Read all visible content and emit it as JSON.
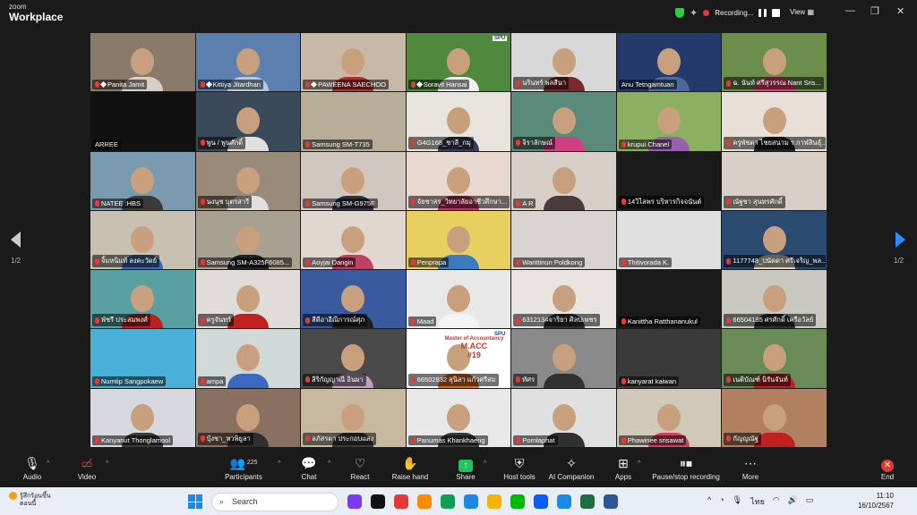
{
  "app": {
    "brand_small": "zoom",
    "brand_large": "Workplace"
  },
  "titlebar": {
    "recording_label": "Recording...",
    "view_label": "View",
    "minimize": "—",
    "restore": "❐",
    "close": "✕"
  },
  "pager": {
    "left": "1/2",
    "right": "1/2"
  },
  "participants": [
    {
      "name": "Panita Jamit",
      "pinned": true,
      "muted": true,
      "bg": "#8a7a6a",
      "shirt": "#d8d0c8"
    },
    {
      "name": "Kittiya Jitardhan",
      "pinned": true,
      "muted": true,
      "bg": "#5c7fb0",
      "shirt": "#b0c8e0"
    },
    {
      "name": "PAWEENA SAECHOO",
      "pinned": true,
      "muted": true,
      "bg": "#c8b8a8",
      "shirt": "#b03030"
    },
    {
      "name": "Soravit Hansai",
      "pinned": true,
      "muted": true,
      "bg": "#4f8a3c",
      "shirt": "#f0f0f0",
      "logo": "SPU"
    },
    {
      "name": "นรินทร์ พลสีนา",
      "pinned": false,
      "muted": true,
      "bg": "#d8d8d8",
      "shirt": "#7a2a2a"
    },
    {
      "name": "Anu Tetngamtuan",
      "pinned": false,
      "muted": false,
      "bg": "#233a6a",
      "shirt": "#4a6a9a"
    },
    {
      "name": "ฉ. นันท์ ศรีสุวรรณ Nant Sris...",
      "pinned": false,
      "muted": true,
      "bg": "#6b8f4a",
      "shirt": "#e04070"
    },
    {
      "name": "ARREE",
      "pinned": false,
      "muted": false,
      "bg": "#111111",
      "shirt": "#111111",
      "noface": true
    },
    {
      "name": "พูน / พูนศักดิ์",
      "pinned": false,
      "muted": true,
      "bg": "#3a4a5a",
      "shirt": "#e0e0e0"
    },
    {
      "name": "Samsung SM-T735",
      "pinned": false,
      "muted": true,
      "bg": "#b8ae98",
      "shirt": "#b8ae98",
      "noface": true
    },
    {
      "name": "G4G168_ชาลี_กมุ",
      "pinned": false,
      "muted": true,
      "bg": "#e8e4de",
      "shirt": "#3a3a5a"
    },
    {
      "name": "จิราลักษณ์",
      "pinned": false,
      "muted": true,
      "bg": "#5a8a7a",
      "shirt": "#d04080"
    },
    {
      "name": "krupui Chanel",
      "pinned": false,
      "muted": true,
      "bg": "#8ab060",
      "shirt": "#9a60b0"
    },
    {
      "name": "ครูพัชดา ไชยสนาม ร.กาฬสินธุ์...",
      "pinned": false,
      "muted": true,
      "bg": "#e8e0d8",
      "shirt": "#202020"
    },
    {
      "name": "NATEE :HBS",
      "pinned": false,
      "muted": true,
      "bg": "#7a9ab0",
      "shirt": "#3a3a3a"
    },
    {
      "name": "นงนุช บุตรสารี",
      "pinned": false,
      "muted": true,
      "bg": "#9a8a7a",
      "shirt": "#e0e0e0"
    },
    {
      "name": "Samsung SM-G975F",
      "pinned": false,
      "muted": true,
      "bg": "#d0c8c0",
      "shirt": "#303040"
    },
    {
      "name": "จัยชาสร_วิทยาลัยอาชีวศึกษา...",
      "pinned": false,
      "muted": true,
      "bg": "#e8d8d0",
      "shirt": "#c03060"
    },
    {
      "name": "A R",
      "pinned": false,
      "muted": true,
      "bg": "#d8d0c8",
      "shirt": "#4a3a3a"
    },
    {
      "name": "14วิไลพร บริหารกิจจนันต์",
      "pinned": false,
      "muted": true,
      "bg": "#1a1a1a",
      "shirt": "#1a1a1a",
      "noface": true
    },
    {
      "name": "ณัฐชา สุนทรศักดิ์",
      "pinned": false,
      "muted": true,
      "bg": "#d8d0c8",
      "shirt": "#d8d0c8",
      "noface": true
    },
    {
      "name": "จิ้มหนิแท้ ลงคะวัดย์",
      "pinned": false,
      "muted": true,
      "bg": "#c8c0b0",
      "shirt": "#3a6ab0"
    },
    {
      "name": "Samsung SM-A325F6085...",
      "pinned": false,
      "muted": true,
      "bg": "#a8a090",
      "shirt": "#202020"
    },
    {
      "name": "Aoyjai Dangin",
      "pinned": false,
      "muted": true,
      "bg": "#e0d8d0",
      "shirt": "#c04060"
    },
    {
      "name": "Penprapa",
      "pinned": false,
      "muted": true,
      "bg": "#e8d060",
      "shirt": "#3a7ac0"
    },
    {
      "name": "Warittinun Poldkong",
      "pinned": false,
      "muted": true,
      "bg": "#d8d4d0",
      "shirt": "#c8a890",
      "noface": true
    },
    {
      "name": "Thitivorada K.",
      "pinned": false,
      "muted": true,
      "bg": "#e0e0e0",
      "shirt": "#b0b0b0",
      "noface": true
    },
    {
      "name": "1177748_ปนัดดา ศรีเจริญ_พล...",
      "pinned": false,
      "muted": true,
      "bg": "#2a4a70",
      "shirt": "#e0d0c0"
    },
    {
      "name": "พัชรี ประสมพงศ์",
      "pinned": false,
      "muted": true,
      "bg": "#5aa0a0",
      "shirt": "#c02020"
    },
    {
      "name": "ครูจันทร์",
      "pinned": false,
      "muted": true,
      "bg": "#e0dcd8",
      "shirt": "#c02020"
    },
    {
      "name": "สีดีอาอีณิการณ์ศุภ",
      "pinned": false,
      "muted": true,
      "bg": "#3a5aa0",
      "shirt": "#202020"
    },
    {
      "name": "Maad",
      "pinned": false,
      "muted": true,
      "bg": "#e8e8e8",
      "shirt": "#f4f4f4"
    },
    {
      "name": "6312134จาริยา ศิลปเพชร",
      "pinned": false,
      "muted": true,
      "bg": "#e8e4e0",
      "shirt": "#303030"
    },
    {
      "name": "Kanittha Ratthananukul",
      "pinned": false,
      "muted": true,
      "bg": "#1a1a1a",
      "shirt": "#1a1a1a",
      "noface": true
    },
    {
      "name": "66504185 ศรศักดิ์ เครือวัลย์",
      "pinned": false,
      "muted": true,
      "bg": "#c8c8c0",
      "shirt": "#303030"
    },
    {
      "name": "Numtip Sangpokaew",
      "pinned": false,
      "muted": true,
      "bg": "#4ab0d8",
      "shirt": "#6ac070",
      "noface": true
    },
    {
      "name": "ampa",
      "pinned": false,
      "muted": true,
      "bg": "#d0d8d8",
      "shirt": "#3a6ac0"
    },
    {
      "name": "สิริกัญญาณี อินผา",
      "pinned": false,
      "muted": true,
      "bg": "#4a4a4a",
      "shirt": "#c0a0c0"
    },
    {
      "name": "66502832 สุนิสา แก้วศรีสม",
      "pinned": false,
      "muted": true,
      "bg": "#ffffff",
      "shirt": "#e07020",
      "logo": "SPU",
      "macc": [
        "Master of Accountancy",
        "M.ACC",
        "#19"
      ]
    },
    {
      "name": "ทัศร",
      "pinned": false,
      "muted": true,
      "bg": "#8a8a8a",
      "shirt": "#303030"
    },
    {
      "name": "kanyarat kaiwan",
      "pinned": false,
      "muted": true,
      "bg": "#3a3a3a",
      "shirt": "#3a3a3a",
      "noface": true
    },
    {
      "name": "เนติบัณฑ์ นิรันจันท์",
      "pinned": false,
      "muted": true,
      "bg": "#6a8a5a",
      "shirt": "#c02020"
    },
    {
      "name": "Kanyanut Thonglamool",
      "pinned": false,
      "muted": true,
      "bg": "#d8d8e0",
      "shirt": "#3a3a3a"
    },
    {
      "name": "บุ้งชา_หวพิยูลา",
      "pinned": false,
      "muted": true,
      "bg": "#8a7060",
      "shirt": "#303030"
    },
    {
      "name": "ลภัสรดา ประกอบแสง",
      "pinned": false,
      "muted": true,
      "bg": "#c8b8a0",
      "shirt": "#3a3a3a"
    },
    {
      "name": "Panumas Khankhaeng",
      "pinned": false,
      "muted": true,
      "bg": "#e8e8e8",
      "shirt": "#3a3a3a"
    },
    {
      "name": "Pornlaphat",
      "pinned": false,
      "muted": true,
      "bg": "#e0e0e0",
      "shirt": "#303030"
    },
    {
      "name": "Phawinee srisawat",
      "pinned": false,
      "muted": true,
      "bg": "#d0c8b8",
      "shirt": "#d04060"
    },
    {
      "name": "กัญญณัฐ",
      "pinned": false,
      "muted": true,
      "bg": "#b08060",
      "shirt": "#c02020"
    }
  ],
  "toolbar": {
    "audio": "Audio",
    "video": "Video",
    "participants": "Participants",
    "participant_count": "225",
    "chat": "Chat",
    "react": "React",
    "raise_hand": "Raise hand",
    "share": "Share",
    "host_tools": "Host tools",
    "ai_companion": "AI Companion",
    "apps": "Apps",
    "pause_stop": "Pause/stop recording",
    "more": "More",
    "end": "End"
  },
  "taskbar": {
    "weather_line1": "รู้สึกร้อนขึ้น",
    "weather_line2": "ตอนนี้",
    "search_placeholder": "Search",
    "lang": "ไทย",
    "time": "11:10",
    "date": "16/10/2567",
    "app_colors": [
      "#7c3aed",
      "#111111",
      "#e53935",
      "#fb8c00",
      "#0f9d58",
      "#1e88e5",
      "#f4b400",
      "#00b900",
      "#0b5cff",
      "#1e88e5",
      "#1d6f42",
      "#2b579a"
    ]
  }
}
